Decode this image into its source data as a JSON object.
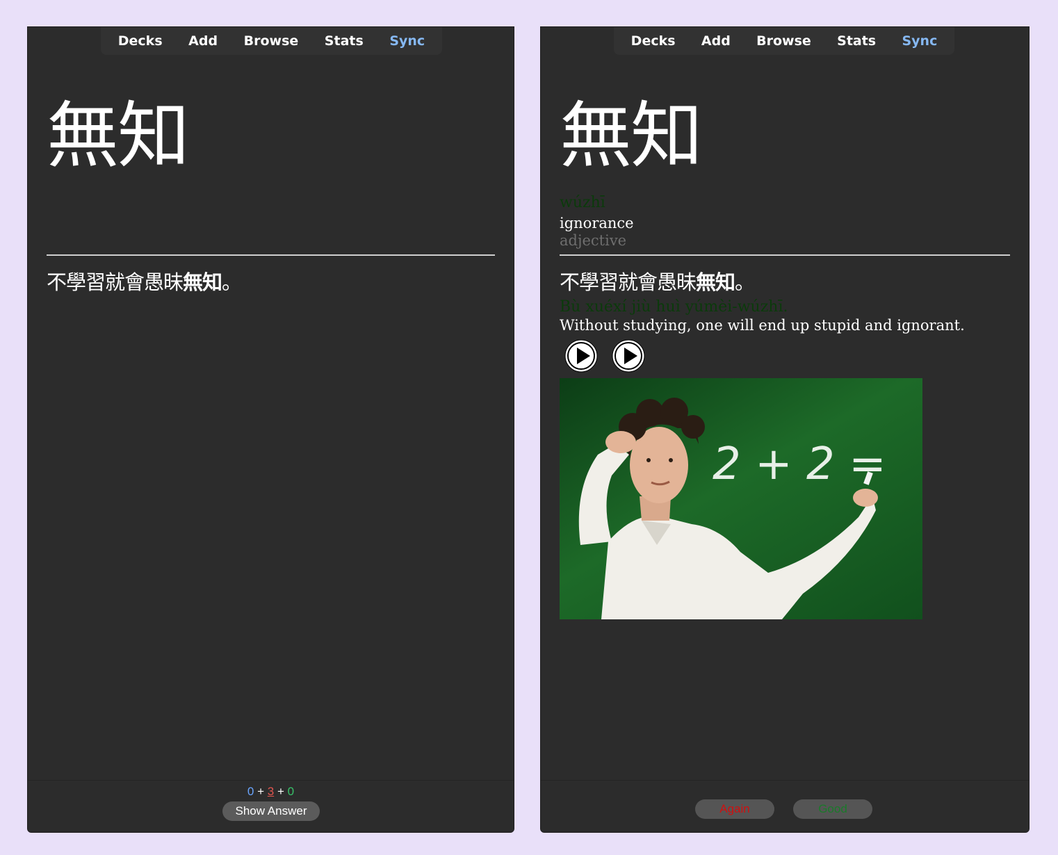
{
  "nav": [
    "Decks",
    "Add",
    "Browse",
    "Stats",
    "Sync"
  ],
  "front": {
    "word": "無知",
    "sentence_plain": "不學習就會愚昧",
    "sentence_bold": "無知",
    "sentence_end": "。",
    "counts": {
      "new": "0",
      "learning": "3",
      "review": "0",
      "sep": "+"
    },
    "show_answer": "Show Answer"
  },
  "back": {
    "word": "無知",
    "pinyin": "wúzhī",
    "meaning": "ignorance",
    "part_of_speech": "adjective",
    "sentence_plain": "不學習就會愚昧",
    "sentence_bold": "無知",
    "sentence_end": "。",
    "sentence_pinyin": "Bù xuéxí jiù huì yúmèi-wúzhī.",
    "translation": "Without studying, one will end up stupid and ignorant.",
    "image_chalk_text": "2 + 2 =",
    "again_label": "Again",
    "good_label": "Good"
  },
  "colors": {
    "window_bg": "#2c2c2c",
    "page_bg": "#e9e0f9",
    "sync_link": "#86b8f2",
    "new_count": "#6aa5ff",
    "learn_count": "#e0554f",
    "review_count": "#38c26a",
    "pinyin": "#0b3a0b",
    "again": "#cf1010",
    "good": "#1a7a2a"
  },
  "icons": [
    "play-icon",
    "play-icon"
  ]
}
